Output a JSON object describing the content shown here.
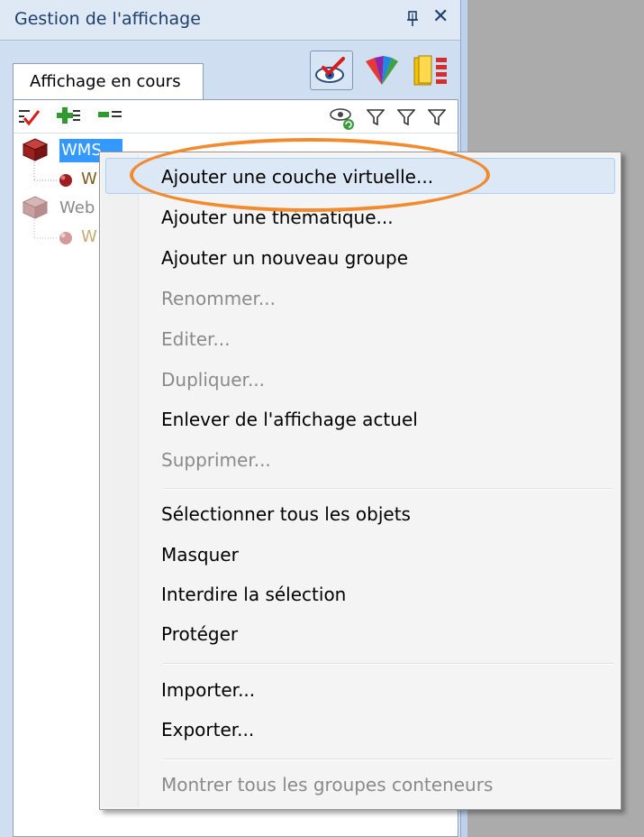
{
  "panel": {
    "title": "Gestion de l'affichage",
    "pin_glyph": "",
    "close_glyph": "✕",
    "tab_label": "Affichage en cours",
    "toolbar_icons": [
      "checklist-icon",
      "add-layer-icon",
      "remove-layer-icon",
      "eye-refresh-icon",
      "filter-icon",
      "filter-icon",
      "filter-icon"
    ],
    "header_icons": [
      "visibility-check-icon",
      "palette-icon",
      "book-list-icon"
    ]
  },
  "tree": {
    "nodes": [
      {
        "label": "WMS",
        "selected": true
      },
      {
        "label": "W",
        "child": true
      },
      {
        "label": "Web",
        "disabled": true
      },
      {
        "label": "W",
        "child": true,
        "disabled": true
      }
    ]
  },
  "context_menu": {
    "groups": [
      [
        {
          "label": "Ajouter une couche virtuelle...",
          "enabled": true,
          "hovered": true
        },
        {
          "label": "Ajouter une thématique...",
          "enabled": true
        },
        {
          "label": "Ajouter un nouveau groupe",
          "enabled": true
        },
        {
          "label": "Renommer...",
          "enabled": false
        },
        {
          "label": "Editer...",
          "enabled": false
        },
        {
          "label": "Dupliquer...",
          "enabled": false
        },
        {
          "label": "Enlever de l'affichage actuel",
          "enabled": true
        },
        {
          "label": "Supprimer...",
          "enabled": false
        }
      ],
      [
        {
          "label": "Sélectionner tous les objets",
          "enabled": true
        },
        {
          "label": "Masquer",
          "enabled": true
        },
        {
          "label": "Interdire la sélection",
          "enabled": true
        },
        {
          "label": "Protéger",
          "enabled": true
        }
      ],
      [
        {
          "label": "Importer...",
          "enabled": true
        },
        {
          "label": "Exporter...",
          "enabled": true
        }
      ],
      [
        {
          "label": "Montrer tous les groupes conteneurs",
          "enabled": false
        }
      ]
    ]
  },
  "colors": {
    "highlight_ellipse": "#f28a2f",
    "selection": "#3399ff",
    "title_text": "#1e3f6b"
  }
}
